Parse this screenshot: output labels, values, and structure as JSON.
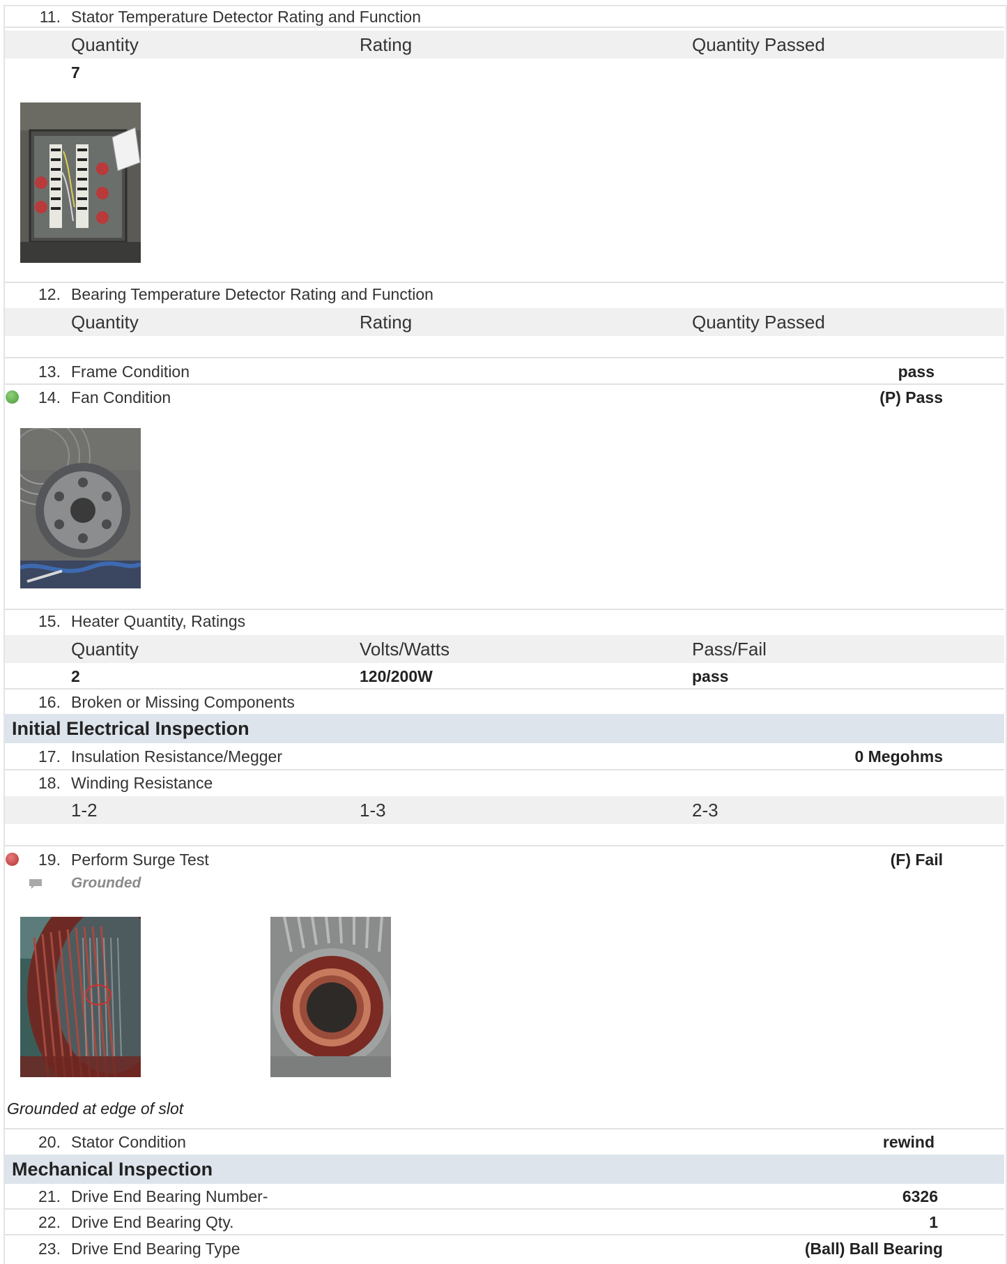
{
  "items": {
    "i11": {
      "num": "11.",
      "label": "Stator Temperature Detector Rating and Function",
      "headers": [
        "Quantity",
        "Rating",
        "Quantity Passed"
      ],
      "values": [
        "7",
        "",
        ""
      ]
    },
    "i12": {
      "num": "12.",
      "label": "Bearing Temperature Detector Rating and Function",
      "headers": [
        "Quantity",
        "Rating",
        "Quantity Passed"
      ]
    },
    "i13": {
      "num": "13.",
      "label": "Frame Condition",
      "value": "pass"
    },
    "i14": {
      "num": "14.",
      "label": "Fan Condition",
      "value": "(P) Pass",
      "status_color": "#4a9a3a"
    },
    "i15": {
      "num": "15.",
      "label": "Heater Quantity, Ratings",
      "headers": [
        "Quantity",
        "Volts/Watts",
        "Pass/Fail"
      ],
      "values": [
        "2",
        "120/200W",
        "pass"
      ]
    },
    "i16": {
      "num": "16.",
      "label": "Broken or Missing Components"
    },
    "i17": {
      "num": "17.",
      "label": "Insulation Resistance/Megger",
      "value": "0 Megohms"
    },
    "i18": {
      "num": "18.",
      "label": "Winding Resistance",
      "headers": [
        "1-2",
        "1-3",
        "2-3"
      ]
    },
    "i19": {
      "num": "19.",
      "label": "Perform Surge Test",
      "value": "(F) Fail",
      "status_color": "#b23232",
      "comment": "Grounded",
      "note": "Grounded at edge of slot"
    },
    "i20": {
      "num": "20.",
      "label": "Stator Condition",
      "value": "rewind"
    },
    "i21": {
      "num": "21.",
      "label": "Drive End Bearing Number-",
      "value": "6326"
    },
    "i22": {
      "num": "22.",
      "label": "Drive End Bearing Qty.",
      "value": "1"
    },
    "i23": {
      "num": "23.",
      "label": "Drive End Bearing Type",
      "value": "(Ball) Ball Bearing"
    }
  },
  "sections": {
    "electrical": "Initial Electrical Inspection",
    "mechanical": "Mechanical Inspection"
  },
  "colors": {
    "section_bg": "#dde4ec",
    "table_header_bg": "#f0f0f0",
    "pass": "#4a9a3a",
    "fail": "#b23232"
  }
}
